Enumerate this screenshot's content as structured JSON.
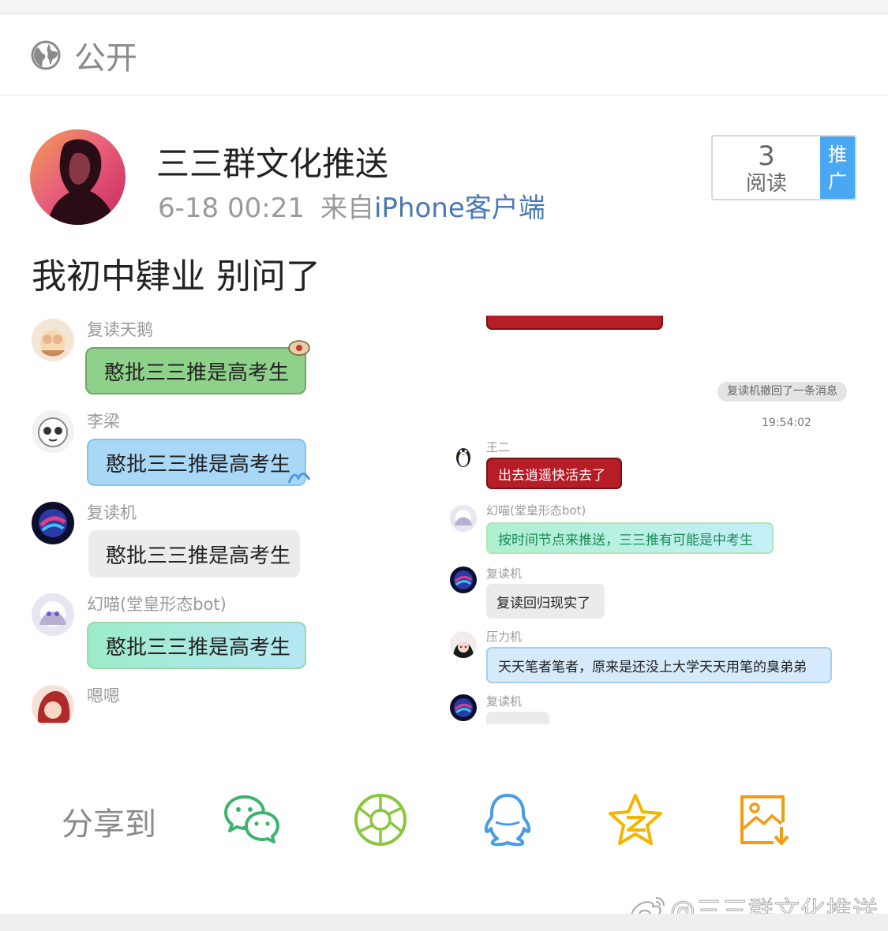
{
  "visibility": {
    "label": "公开",
    "icon": "globe-icon"
  },
  "post": {
    "author": "三三群文化推送",
    "timestamp": "6-18 00:21",
    "source_prefix": "来自",
    "source_client": "iPhone客户端",
    "read_count": "3",
    "read_label": "阅读",
    "promote_label": "推广",
    "text": "我初中肄业 别问了"
  },
  "chat_left": {
    "messages": [
      {
        "sender": "复读天鹅",
        "text": "憨批三三推是高考生"
      },
      {
        "sender": "李梁",
        "text": "憨批三三推是高考生"
      },
      {
        "sender": "复读机",
        "text": "憨批三三推是高考生"
      },
      {
        "sender": "幻喵(堂皇形态bot)",
        "text": "憨批三三推是高考生"
      },
      {
        "sender": "嗯嗯",
        "text": ""
      }
    ]
  },
  "chat_right": {
    "system_message": "复读机撤回了一条消息",
    "time": "19:54:02",
    "messages": [
      {
        "sender": "王二",
        "text": "出去逍遥快活去了"
      },
      {
        "sender": "幻喵(堂皇形态bot)",
        "text": "按时间节点来推送，三三推有可能是中考生"
      },
      {
        "sender": "复读机",
        "text": "复读回归现实了"
      },
      {
        "sender": "压力机",
        "text": "天天笔者笔者，原来是还没上大学天天用笔的臭弟弟"
      },
      {
        "sender": "复读机",
        "text": ""
      }
    ]
  },
  "share": {
    "label": "分享到",
    "targets": [
      "wechat-icon",
      "moments-icon",
      "qq-icon",
      "qzone-icon",
      "save-image-icon"
    ]
  },
  "watermark": {
    "text": "@三三群文化推送",
    "icon": "weibo-logo-icon"
  },
  "colors": {
    "link_blue": "#4a78b4",
    "promote_blue": "#4aa8f2",
    "wechat_green": "#3cb46e",
    "moments_green": "#8cc63f",
    "qq_blue": "#4a9be6",
    "qzone_yellow": "#f5b400",
    "save_orange": "#f39c12"
  }
}
